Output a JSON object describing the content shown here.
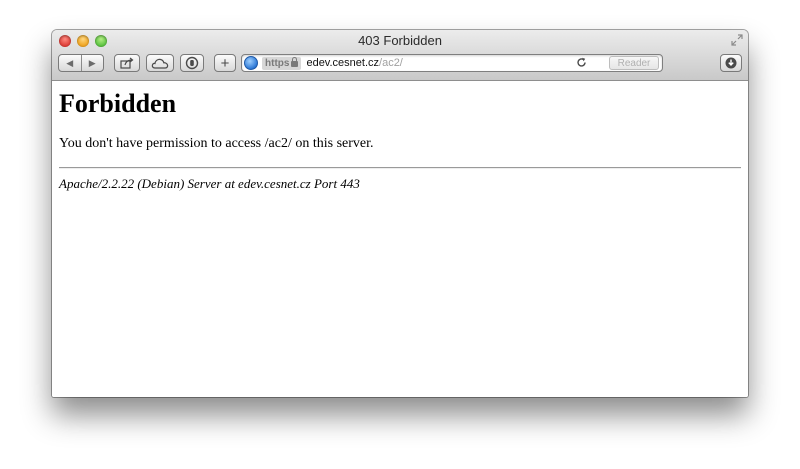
{
  "window": {
    "title": "403 Forbidden"
  },
  "toolbar": {
    "back_icon": "back-arrow-icon",
    "forward_icon": "forward-arrow-icon",
    "share_icon": "share-icon",
    "icloud_icon": "icloud-icon",
    "reading_list_icon": "reading-list-icon",
    "add_icon": "plus-icon",
    "download_icon": "download-icon"
  },
  "address_bar": {
    "scheme": "https",
    "host": "edev.cesnet.cz",
    "path": "/ac2/",
    "reload_icon": "reload-icon",
    "reader_label": "Reader"
  },
  "page": {
    "heading": "Forbidden",
    "message": "You don't have permission to access /ac2/ on this server.",
    "server_address": "Apache/2.2.22 (Debian) Server at edev.cesnet.cz Port 443"
  },
  "colors": {
    "traffic_close": "#e0443e",
    "traffic_minimize": "#f1a929",
    "traffic_zoom": "#63c646",
    "globe": "#2d78d6"
  }
}
